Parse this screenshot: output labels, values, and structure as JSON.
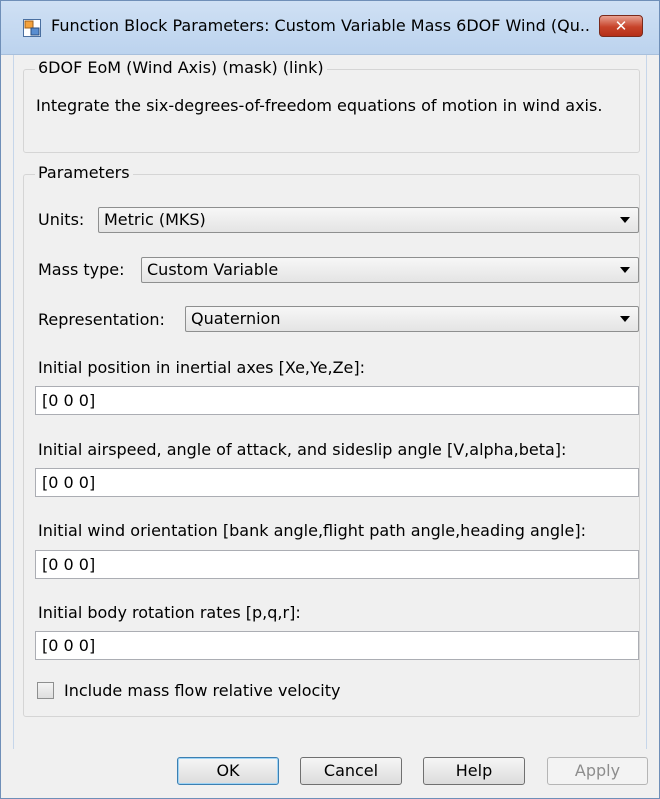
{
  "window": {
    "title": "Function Block Parameters: Custom Variable Mass 6DOF Wind (Qu...",
    "close_label": "✕"
  },
  "description": {
    "group_title": "6DOF EoM (Wind Axis) (mask) (link)",
    "text": "Integrate the six-degrees-of-freedom equations of motion in wind axis."
  },
  "parameters": {
    "group_title": "Parameters",
    "units": {
      "label": "Units:",
      "value": "Metric (MKS)"
    },
    "mass_type": {
      "label": "Mass type:",
      "value": "Custom Variable"
    },
    "representation": {
      "label": "Representation:",
      "value": "Quaternion"
    },
    "initial_position": {
      "label": "Initial position in inertial axes [Xe,Ye,Ze]:",
      "value": "[0 0 0]"
    },
    "initial_airspeed": {
      "label": "Initial airspeed, angle of attack, and sideslip angle [V,alpha,beta]:",
      "value": "[0 0 0]"
    },
    "initial_wind_orientation": {
      "label": "Initial wind orientation [bank angle,flight path angle,heading angle]:",
      "value": "[0 0 0]"
    },
    "initial_body_rates": {
      "label": "Initial body rotation rates [p,q,r]:",
      "value": "[0 0 0]"
    },
    "mass_flow_checkbox": {
      "label": "Include mass flow relative velocity",
      "checked": false
    }
  },
  "buttons": {
    "ok": "OK",
    "cancel": "Cancel",
    "help": "Help",
    "apply": "Apply"
  },
  "icons": {
    "app": "simulink-block-icon",
    "close": "close-icon",
    "dropdown": "chevron-down-icon"
  },
  "colors": {
    "titlebar": "#c4d8f0",
    "close_button": "#c7432a",
    "dialog_bg": "#f0f0f0"
  }
}
